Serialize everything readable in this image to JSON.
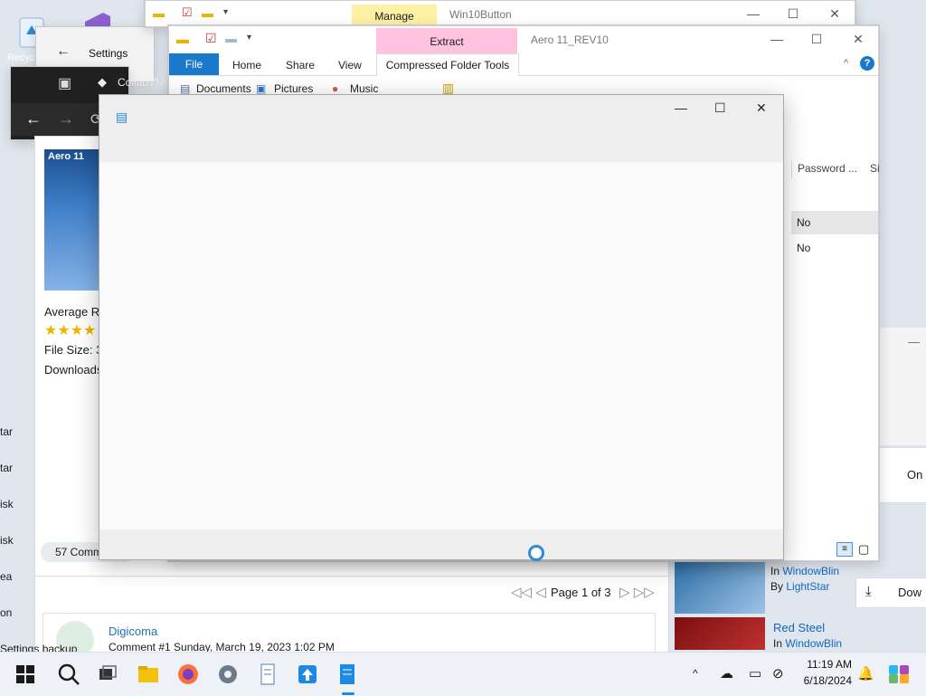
{
  "desktop": {
    "recycle_label": "Recycle"
  },
  "settings": {
    "title": "Settings",
    "back_glyph": "←"
  },
  "browser": {
    "tab_title": "CollabVM",
    "back_glyph": "←",
    "forward_glyph": "→"
  },
  "skin_page": {
    "thumb_title": "Aero 11",
    "average_rating": "Average Ra",
    "file_size": "File Size: 3.",
    "downloads": "Downloads",
    "comments_tab": "57 Comm",
    "pager": "Page 1 of 3",
    "comment_author": "Digicoma",
    "comment_meta": "Comment #1 Sunday, March 19, 2023 1:02 PM",
    "side_labels": [
      "tar",
      "tar",
      "isk",
      "isk",
      "ea",
      "on"
    ],
    "settings_backup": "Settings backup"
  },
  "right_panel": {
    "item1_in": "In",
    "item1_site": "WindowBlin",
    "item1_by": "By",
    "item1_author": "LightStar",
    "item2_title": "Red Steel",
    "item2_in": "In",
    "item2_site": "WindowBlin",
    "on_label": "On",
    "down_label": "Dow"
  },
  "explorer_back": {
    "contextual_tab": "Manage",
    "title": "Win10Button"
  },
  "explorer_main": {
    "contextual_tab": "Extract",
    "title": "Aero 11_REV10",
    "tabs": [
      "File",
      "Home",
      "Share",
      "View",
      "Compressed Folder Tools"
    ],
    "favorites": [
      "Documents",
      "Pictures",
      "Music"
    ],
    "column_header": "Password ...",
    "column_header2": "Si",
    "rows": [
      "No",
      "No"
    ]
  },
  "window_controls": {
    "minimize": "—",
    "maximize": "☐",
    "close": "✕"
  },
  "taskbar": {
    "time": "11:19 AM",
    "date": "6/18/2024"
  },
  "colors": {
    "file_tab": "#1979ca",
    "manage_tab": "#fdf1a4",
    "extract_tab": "#ffc3df",
    "accent": "#0078d4"
  }
}
